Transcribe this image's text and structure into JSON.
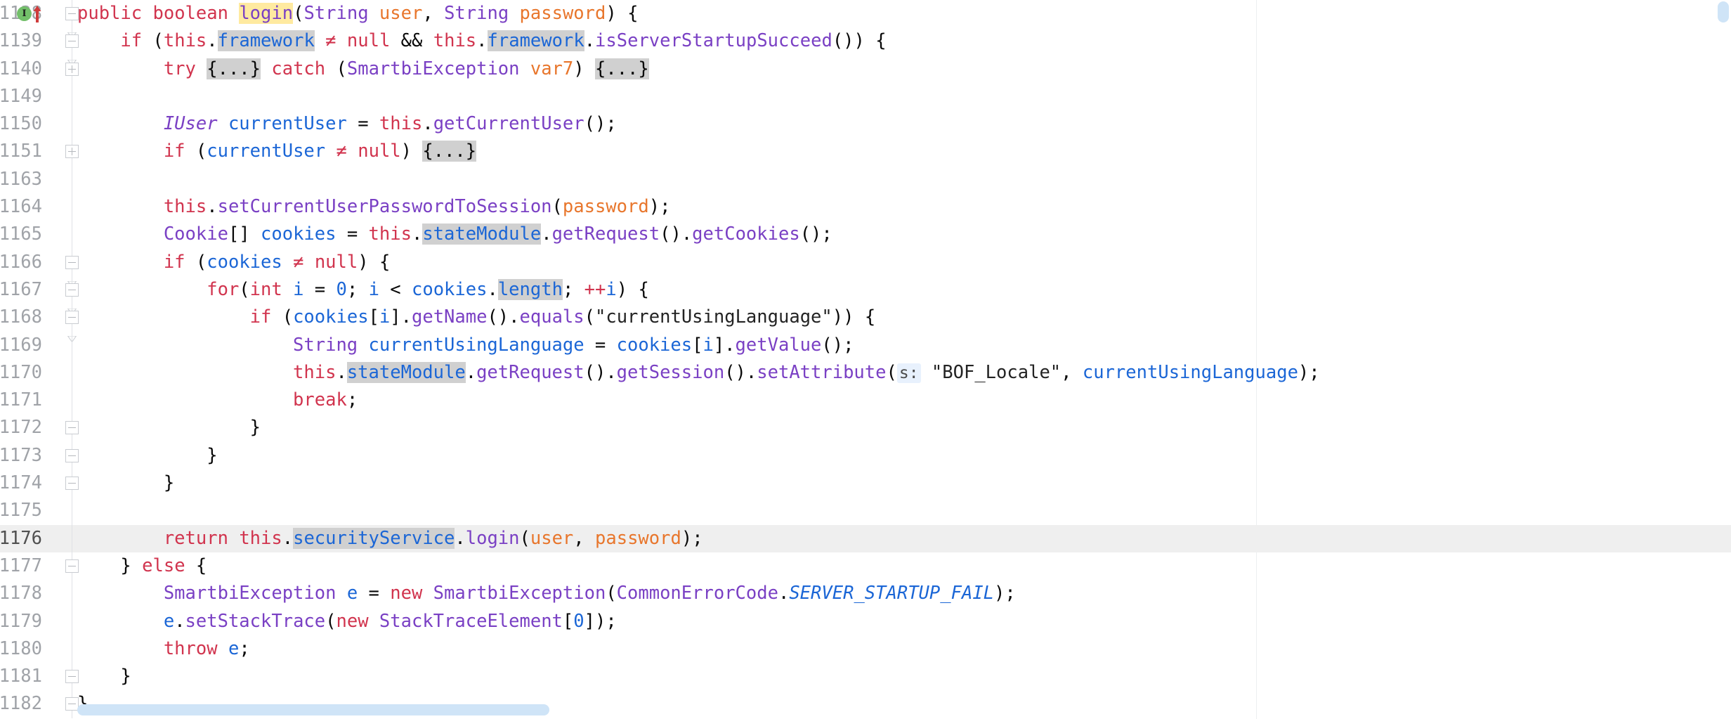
{
  "editor": {
    "language": "java",
    "theme": "IntelliJ Light",
    "caret_line": 176,
    "colors": {
      "background": "#ffffff",
      "current_line": "#efefef",
      "keyword": "#d1344e",
      "type": "#7a40c4",
      "field": "#1b66d6",
      "parameter": "#e8762c",
      "usage_highlight": "#d0d0d0",
      "declaration_highlight": "#ffeaa0",
      "param_hint_bg": "#e8f1fd",
      "line_number": "#a0a3a8",
      "scrollbar_thumb": "#cfe4f7",
      "wrap_guide": "#eceff1",
      "impl_marker_green": "#73bf6a",
      "override_marker_red": "#cf3b3b"
    }
  },
  "gutter": {
    "markers": {
      "implemented_icon": "implemented-method-icon",
      "implemented_letter": "I",
      "overriding_icon": "overriding-method-arrow-icon"
    },
    "fold_expanded_icon": "fold-collapse-icon",
    "fold_collapsed_icon": "fold-expand-icon"
  },
  "scrollbars": {
    "horizontal": {
      "name": "horizontal-scrollbar",
      "thumb_left_pct": 0,
      "thumb_width_pct": 32
    },
    "vertical": {
      "name": "vertical-scrollbar",
      "thumb_top_pct": 0,
      "thumb_height_pct": 3
    }
  },
  "lines": [
    {
      "number": "1138",
      "fold": "collapse-arrow",
      "markers": [
        "implemented",
        "overriding"
      ],
      "current": false,
      "tokens": [
        {
          "t": "public",
          "c": "kw"
        },
        {
          "t": " ",
          "c": "punc"
        },
        {
          "t": "boolean",
          "c": "kw"
        },
        {
          "t": " ",
          "c": "punc"
        },
        {
          "t": "login",
          "c": "mth",
          "hl": "decl"
        },
        {
          "t": "(",
          "c": "punc"
        },
        {
          "t": "String",
          "c": "typ"
        },
        {
          "t": " ",
          "c": "punc"
        },
        {
          "t": "user",
          "c": "prm"
        },
        {
          "t": ", ",
          "c": "punc"
        },
        {
          "t": "String",
          "c": "typ"
        },
        {
          "t": " ",
          "c": "punc"
        },
        {
          "t": "password",
          "c": "prm"
        },
        {
          "t": ") {",
          "c": "punc"
        }
      ],
      "indent": 0
    },
    {
      "number": "1139",
      "fold": "collapse-arrow",
      "markers": [],
      "current": false,
      "tokens": [
        {
          "t": "if",
          "c": "kw"
        },
        {
          "t": " (",
          "c": "punc"
        },
        {
          "t": "this",
          "c": "kw"
        },
        {
          "t": ".",
          "c": "punc"
        },
        {
          "t": "framework",
          "c": "fld",
          "hl": "usage"
        },
        {
          "t": " ",
          "c": "punc"
        },
        {
          "t": "≠",
          "c": "op"
        },
        {
          "t": " ",
          "c": "punc"
        },
        {
          "t": "null",
          "c": "kw"
        },
        {
          "t": " && ",
          "c": "punc"
        },
        {
          "t": "this",
          "c": "kw"
        },
        {
          "t": ".",
          "c": "punc"
        },
        {
          "t": "framework",
          "c": "fld",
          "hl": "usage"
        },
        {
          "t": ".",
          "c": "punc"
        },
        {
          "t": "isServerStartupSucceed",
          "c": "mth"
        },
        {
          "t": "()) {",
          "c": "punc"
        }
      ],
      "indent": 1
    },
    {
      "number": "1140",
      "fold": "expand",
      "markers": [],
      "current": false,
      "tokens": [
        {
          "t": "try",
          "c": "kw"
        },
        {
          "t": " ",
          "c": "punc"
        },
        {
          "t": "{...}",
          "c": "punc",
          "hl": "usage"
        },
        {
          "t": " ",
          "c": "punc"
        },
        {
          "t": "catch",
          "c": "kw"
        },
        {
          "t": " (",
          "c": "punc"
        },
        {
          "t": "SmartbiException",
          "c": "typ"
        },
        {
          "t": " ",
          "c": "punc"
        },
        {
          "t": "var7",
          "c": "prm"
        },
        {
          "t": ") ",
          "c": "punc"
        },
        {
          "t": "{...}",
          "c": "punc",
          "hl": "usage"
        }
      ],
      "indent": 2
    },
    {
      "number": "1149",
      "fold": "none",
      "markers": [],
      "current": false,
      "tokens": [],
      "indent": 0
    },
    {
      "number": "1150",
      "fold": "none",
      "markers": [],
      "current": false,
      "tokens": [
        {
          "t": "IUser",
          "c": "typ-i"
        },
        {
          "t": " ",
          "c": "punc"
        },
        {
          "t": "currentUser",
          "c": "fld"
        },
        {
          "t": " = ",
          "c": "punc"
        },
        {
          "t": "this",
          "c": "kw"
        },
        {
          "t": ".",
          "c": "punc"
        },
        {
          "t": "getCurrentUser",
          "c": "mth"
        },
        {
          "t": "();",
          "c": "punc"
        }
      ],
      "indent": 2
    },
    {
      "number": "1151",
      "fold": "expand",
      "markers": [],
      "current": false,
      "tokens": [
        {
          "t": "if",
          "c": "kw"
        },
        {
          "t": " (",
          "c": "punc"
        },
        {
          "t": "currentUser",
          "c": "fld"
        },
        {
          "t": " ",
          "c": "punc"
        },
        {
          "t": "≠",
          "c": "op"
        },
        {
          "t": " ",
          "c": "punc"
        },
        {
          "t": "null",
          "c": "kw"
        },
        {
          "t": ") ",
          "c": "punc"
        },
        {
          "t": "{...}",
          "c": "punc",
          "hl": "usage"
        }
      ],
      "indent": 2
    },
    {
      "number": "1163",
      "fold": "none",
      "markers": [],
      "current": false,
      "tokens": [],
      "indent": 0
    },
    {
      "number": "1164",
      "fold": "none",
      "markers": [],
      "current": false,
      "tokens": [
        {
          "t": "this",
          "c": "kw"
        },
        {
          "t": ".",
          "c": "punc"
        },
        {
          "t": "setCurrentUserPasswordToSession",
          "c": "mth"
        },
        {
          "t": "(",
          "c": "punc"
        },
        {
          "t": "password",
          "c": "prm"
        },
        {
          "t": ");",
          "c": "punc"
        }
      ],
      "indent": 2
    },
    {
      "number": "1165",
      "fold": "none",
      "markers": [],
      "current": false,
      "tokens": [
        {
          "t": "Cookie",
          "c": "typ"
        },
        {
          "t": "[] ",
          "c": "punc"
        },
        {
          "t": "cookies",
          "c": "fld"
        },
        {
          "t": " = ",
          "c": "punc"
        },
        {
          "t": "this",
          "c": "kw"
        },
        {
          "t": ".",
          "c": "punc"
        },
        {
          "t": "stateModule",
          "c": "fld",
          "hl": "usage"
        },
        {
          "t": ".",
          "c": "punc"
        },
        {
          "t": "getRequest",
          "c": "mth"
        },
        {
          "t": "().",
          "c": "punc"
        },
        {
          "t": "getCookies",
          "c": "mth"
        },
        {
          "t": "();",
          "c": "punc"
        }
      ],
      "indent": 2
    },
    {
      "number": "1166",
      "fold": "collapse-arrow",
      "markers": [],
      "current": false,
      "tokens": [
        {
          "t": "if",
          "c": "kw"
        },
        {
          "t": " (",
          "c": "punc"
        },
        {
          "t": "cookies",
          "c": "fld"
        },
        {
          "t": " ",
          "c": "punc"
        },
        {
          "t": "≠",
          "c": "op"
        },
        {
          "t": " ",
          "c": "punc"
        },
        {
          "t": "null",
          "c": "kw"
        },
        {
          "t": ") {",
          "c": "punc"
        }
      ],
      "indent": 2
    },
    {
      "number": "1167",
      "fold": "collapse-arrow",
      "markers": [],
      "current": false,
      "tokens": [
        {
          "t": "for",
          "c": "kw"
        },
        {
          "t": "(",
          "c": "punc"
        },
        {
          "t": "int",
          "c": "kw"
        },
        {
          "t": " ",
          "c": "punc"
        },
        {
          "t": "i",
          "c": "fld"
        },
        {
          "t": " = ",
          "c": "punc"
        },
        {
          "t": "0",
          "c": "num"
        },
        {
          "t": "; ",
          "c": "punc"
        },
        {
          "t": "i",
          "c": "fld"
        },
        {
          "t": " < ",
          "c": "punc"
        },
        {
          "t": "cookies",
          "c": "fld"
        },
        {
          "t": ".",
          "c": "punc"
        },
        {
          "t": "length",
          "c": "fld",
          "hl": "usage"
        },
        {
          "t": "; ",
          "c": "punc"
        },
        {
          "t": "++",
          "c": "op"
        },
        {
          "t": "i",
          "c": "fld"
        },
        {
          "t": ") {",
          "c": "punc"
        }
      ],
      "indent": 3
    },
    {
      "number": "1168",
      "fold": "collapse-arrow",
      "markers": [],
      "current": false,
      "tokens": [
        {
          "t": "if",
          "c": "kw"
        },
        {
          "t": " (",
          "c": "punc"
        },
        {
          "t": "cookies",
          "c": "fld"
        },
        {
          "t": "[",
          "c": "punc"
        },
        {
          "t": "i",
          "c": "fld"
        },
        {
          "t": "].",
          "c": "punc"
        },
        {
          "t": "getName",
          "c": "mth"
        },
        {
          "t": "().",
          "c": "punc"
        },
        {
          "t": "equals",
          "c": "mth"
        },
        {
          "t": "(",
          "c": "punc"
        },
        {
          "t": "\"currentUsingLanguage\"",
          "c": "strlit"
        },
        {
          "t": ")) {",
          "c": "punc"
        }
      ],
      "indent": 4
    },
    {
      "number": "1169",
      "fold": "none",
      "markers": [],
      "current": false,
      "tokens": [
        {
          "t": "String",
          "c": "typ"
        },
        {
          "t": " ",
          "c": "punc"
        },
        {
          "t": "currentUsingLanguage",
          "c": "fld"
        },
        {
          "t": " = ",
          "c": "punc"
        },
        {
          "t": "cookies",
          "c": "fld"
        },
        {
          "t": "[",
          "c": "punc"
        },
        {
          "t": "i",
          "c": "fld"
        },
        {
          "t": "].",
          "c": "punc"
        },
        {
          "t": "getValue",
          "c": "mth"
        },
        {
          "t": "();",
          "c": "punc"
        }
      ],
      "indent": 5
    },
    {
      "number": "1170",
      "fold": "none",
      "markers": [],
      "current": false,
      "tokens": [
        {
          "t": "this",
          "c": "kw"
        },
        {
          "t": ".",
          "c": "punc"
        },
        {
          "t": "stateModule",
          "c": "fld",
          "hl": "usage"
        },
        {
          "t": ".",
          "c": "punc"
        },
        {
          "t": "getRequest",
          "c": "mth"
        },
        {
          "t": "().",
          "c": "punc"
        },
        {
          "t": "getSession",
          "c": "mth"
        },
        {
          "t": "().",
          "c": "punc"
        },
        {
          "t": "setAttribute",
          "c": "mth"
        },
        {
          "t": "(",
          "c": "punc"
        },
        {
          "t": "s:",
          "c": "hint"
        },
        {
          "t": " ",
          "c": "punc"
        },
        {
          "t": "\"BOF_Locale\"",
          "c": "strlit"
        },
        {
          "t": ", ",
          "c": "punc"
        },
        {
          "t": "currentUsingLanguage",
          "c": "fld"
        },
        {
          "t": ");",
          "c": "punc"
        }
      ],
      "indent": 5
    },
    {
      "number": "1171",
      "fold": "none",
      "markers": [],
      "current": false,
      "tokens": [
        {
          "t": "break",
          "c": "kw"
        },
        {
          "t": ";",
          "c": "punc"
        }
      ],
      "indent": 5
    },
    {
      "number": "1172",
      "fold": "collapse-end",
      "markers": [],
      "current": false,
      "tokens": [
        {
          "t": "}",
          "c": "punc"
        }
      ],
      "indent": 4
    },
    {
      "number": "1173",
      "fold": "collapse-end",
      "markers": [],
      "current": false,
      "tokens": [
        {
          "t": "}",
          "c": "punc"
        }
      ],
      "indent": 3
    },
    {
      "number": "1174",
      "fold": "collapse-end",
      "markers": [],
      "current": false,
      "tokens": [
        {
          "t": "}",
          "c": "punc"
        }
      ],
      "indent": 2
    },
    {
      "number": "1175",
      "fold": "none",
      "markers": [],
      "current": false,
      "tokens": [],
      "indent": 0
    },
    {
      "number": "1176",
      "fold": "none",
      "markers": [],
      "current": true,
      "tokens": [
        {
          "t": "return",
          "c": "kw"
        },
        {
          "t": " ",
          "c": "punc"
        },
        {
          "t": "this",
          "c": "kw"
        },
        {
          "t": ".",
          "c": "punc"
        },
        {
          "t": "securityService",
          "c": "fld",
          "hl": "usage"
        },
        {
          "t": ".",
          "c": "punc"
        },
        {
          "t": "login",
          "c": "mth"
        },
        {
          "t": "(",
          "c": "punc"
        },
        {
          "t": "user",
          "c": "prm"
        },
        {
          "t": ", ",
          "c": "punc"
        },
        {
          "t": "password",
          "c": "prm"
        },
        {
          "t": ");",
          "c": "punc"
        }
      ],
      "indent": 2
    },
    {
      "number": "1177",
      "fold": "collapse-end",
      "markers": [],
      "current": false,
      "tokens": [
        {
          "t": "} ",
          "c": "punc"
        },
        {
          "t": "else",
          "c": "kw"
        },
        {
          "t": " {",
          "c": "punc"
        }
      ],
      "indent": 1
    },
    {
      "number": "1178",
      "fold": "none",
      "markers": [],
      "current": false,
      "tokens": [
        {
          "t": "SmartbiException",
          "c": "typ"
        },
        {
          "t": " ",
          "c": "punc"
        },
        {
          "t": "e",
          "c": "fld"
        },
        {
          "t": " = ",
          "c": "punc"
        },
        {
          "t": "new",
          "c": "kw"
        },
        {
          "t": " ",
          "c": "punc"
        },
        {
          "t": "SmartbiException",
          "c": "typ"
        },
        {
          "t": "(",
          "c": "punc"
        },
        {
          "t": "CommonErrorCode",
          "c": "typ"
        },
        {
          "t": ".",
          "c": "punc"
        },
        {
          "t": "SERVER_STARTUP_FAIL",
          "c": "cnst"
        },
        {
          "t": ");",
          "c": "punc"
        }
      ],
      "indent": 2
    },
    {
      "number": "1179",
      "fold": "none",
      "markers": [],
      "current": false,
      "tokens": [
        {
          "t": "e",
          "c": "fld"
        },
        {
          "t": ".",
          "c": "punc"
        },
        {
          "t": "setStackTrace",
          "c": "mth"
        },
        {
          "t": "(",
          "c": "punc"
        },
        {
          "t": "new",
          "c": "kw"
        },
        {
          "t": " ",
          "c": "punc"
        },
        {
          "t": "StackTraceElement",
          "c": "typ"
        },
        {
          "t": "[",
          "c": "punc"
        },
        {
          "t": "0",
          "c": "num"
        },
        {
          "t": "]);",
          "c": "punc"
        }
      ],
      "indent": 2
    },
    {
      "number": "1180",
      "fold": "none",
      "markers": [],
      "current": false,
      "tokens": [
        {
          "t": "throw",
          "c": "kw"
        },
        {
          "t": " ",
          "c": "punc"
        },
        {
          "t": "e",
          "c": "fld"
        },
        {
          "t": ";",
          "c": "punc"
        }
      ],
      "indent": 2
    },
    {
      "number": "1181",
      "fold": "collapse-end",
      "markers": [],
      "current": false,
      "tokens": [
        {
          "t": "}",
          "c": "punc"
        }
      ],
      "indent": 1
    },
    {
      "number": "1182",
      "fold": "collapse-end",
      "markers": [],
      "current": false,
      "tokens": [
        {
          "t": "}",
          "c": "punc"
        }
      ],
      "indent": 0
    }
  ]
}
